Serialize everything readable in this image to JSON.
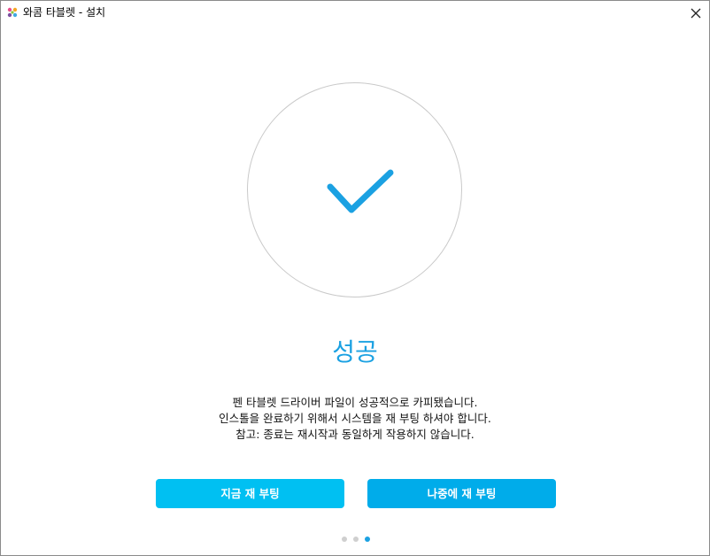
{
  "window": {
    "title": "와콤 타블렛 - 설치"
  },
  "icons": {
    "app": "wacom-logo-icon",
    "close": "close-icon",
    "success": "checkmark-icon"
  },
  "main": {
    "heading": "성공",
    "message_lines": [
      "펜 타블렛 드라이버 파일이 성공적으로 카피됐습니다.",
      "인스톨을 완료하기 위해서 시스템을 재 부팅 하셔야 합니다.",
      "참고: 종료는 재시작과 동일하게 작용하지 않습니다."
    ]
  },
  "buttons": {
    "restart_now": "지금 재 부팅",
    "restart_later": "나중에 재 부팅"
  },
  "pagination": {
    "total": 3,
    "current": 3
  },
  "colors": {
    "accent": "#1ba1e2",
    "button_primary": "#00c0f2",
    "button_secondary": "#00acea",
    "circle_border": "#c9c9c9"
  }
}
